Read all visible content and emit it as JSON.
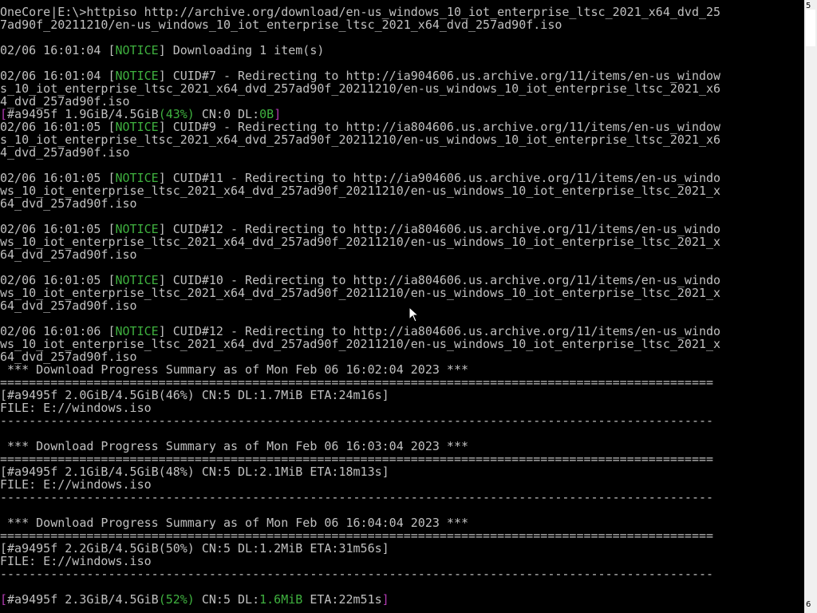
{
  "terminal": {
    "lines": [
      [
        {
          "t": "OneCore|E:\\>httpiso http://archive.org/download/en-us_windows_10_iot_enterprise_ltsc_2021_x64_dvd_25",
          "c": ""
        }
      ],
      [
        {
          "t": "7ad90f_20211210/en-us_windows_10_iot_enterprise_ltsc_2021_x64_dvd_257ad90f.iso",
          "c": ""
        }
      ],
      [],
      [
        {
          "t": "02/06 16:01:04 [",
          "c": ""
        },
        {
          "t": "NOTICE",
          "c": "notice"
        },
        {
          "t": "] Downloading 1 item(s)",
          "c": ""
        }
      ],
      [],
      [
        {
          "t": "02/06 16:01:04 [",
          "c": ""
        },
        {
          "t": "NOTICE",
          "c": "notice"
        },
        {
          "t": "] CUID#7 - Redirecting to http://ia904606.us.archive.org/11/items/en-us_window",
          "c": ""
        }
      ],
      [
        {
          "t": "s_10_iot_enterprise_ltsc_2021_x64_dvd_257ad90f_20211210/en-us_windows_10_iot_enterprise_ltsc_2021_x6",
          "c": ""
        }
      ],
      [
        {
          "t": "4_dvd_257ad90f.iso",
          "c": ""
        }
      ],
      [
        {
          "t": "[",
          "c": "magenta"
        },
        {
          "t": "#a9495f 1.9GiB/4.5GiB",
          "c": ""
        },
        {
          "t": "(43%)",
          "c": "green"
        },
        {
          "t": " CN:0 DL:",
          "c": ""
        },
        {
          "t": "0B",
          "c": "green"
        },
        {
          "t": "]",
          "c": "magenta"
        }
      ],
      [
        {
          "t": "02/06 16:01:05 [",
          "c": ""
        },
        {
          "t": "NOTICE",
          "c": "notice"
        },
        {
          "t": "] CUID#9 - Redirecting to http://ia804606.us.archive.org/11/items/en-us_window",
          "c": ""
        }
      ],
      [
        {
          "t": "s_10_iot_enterprise_ltsc_2021_x64_dvd_257ad90f_20211210/en-us_windows_10_iot_enterprise_ltsc_2021_x6",
          "c": ""
        }
      ],
      [
        {
          "t": "4_dvd_257ad90f.iso",
          "c": ""
        }
      ],
      [],
      [
        {
          "t": "02/06 16:01:05 [",
          "c": ""
        },
        {
          "t": "NOTICE",
          "c": "notice"
        },
        {
          "t": "] CUID#11 - Redirecting to http://ia904606.us.archive.org/11/items/en-us_windo",
          "c": ""
        }
      ],
      [
        {
          "t": "ws_10_iot_enterprise_ltsc_2021_x64_dvd_257ad90f_20211210/en-us_windows_10_iot_enterprise_ltsc_2021_x",
          "c": ""
        }
      ],
      [
        {
          "t": "64_dvd_257ad90f.iso",
          "c": ""
        }
      ],
      [],
      [
        {
          "t": "02/06 16:01:05 [",
          "c": ""
        },
        {
          "t": "NOTICE",
          "c": "notice"
        },
        {
          "t": "] CUID#12 - Redirecting to http://ia804606.us.archive.org/11/items/en-us_windo",
          "c": ""
        }
      ],
      [
        {
          "t": "ws_10_iot_enterprise_ltsc_2021_x64_dvd_257ad90f_20211210/en-us_windows_10_iot_enterprise_ltsc_2021_x",
          "c": ""
        }
      ],
      [
        {
          "t": "64_dvd_257ad90f.iso",
          "c": ""
        }
      ],
      [],
      [
        {
          "t": "02/06 16:01:05 [",
          "c": ""
        },
        {
          "t": "NOTICE",
          "c": "notice"
        },
        {
          "t": "] CUID#10 - Redirecting to http://ia804606.us.archive.org/11/items/en-us_windo",
          "c": ""
        }
      ],
      [
        {
          "t": "ws_10_iot_enterprise_ltsc_2021_x64_dvd_257ad90f_20211210/en-us_windows_10_iot_enterprise_ltsc_2021_x",
          "c": ""
        }
      ],
      [
        {
          "t": "64_dvd_257ad90f.iso",
          "c": ""
        }
      ],
      [],
      [
        {
          "t": "02/06 16:01:06 [",
          "c": ""
        },
        {
          "t": "NOTICE",
          "c": "notice"
        },
        {
          "t": "] CUID#12 - Redirecting to http://ia804606.us.archive.org/11/items/en-us_windo",
          "c": ""
        }
      ],
      [
        {
          "t": "ws_10_iot_enterprise_ltsc_2021_x64_dvd_257ad90f_20211210/en-us_windows_10_iot_enterprise_ltsc_2021_x",
          "c": ""
        }
      ],
      [
        {
          "t": "64_dvd_257ad90f.iso",
          "c": ""
        }
      ],
      [
        {
          "t": " *** Download Progress Summary as of Mon Feb 06 16:02:04 2023 ***",
          "c": ""
        }
      ],
      [
        {
          "t": "===================================================================================================",
          "c": ""
        }
      ],
      [
        {
          "t": "[#a9495f 2.0GiB/4.5GiB(46%) CN:5 DL:1.7MiB ETA:24m16s]",
          "c": ""
        }
      ],
      [
        {
          "t": "FILE: E://windows.iso",
          "c": ""
        }
      ],
      [
        {
          "t": "---------------------------------------------------------------------------------------------------",
          "c": ""
        }
      ],
      [],
      [
        {
          "t": " *** Download Progress Summary as of Mon Feb 06 16:03:04 2023 ***",
          "c": ""
        }
      ],
      [
        {
          "t": "===================================================================================================",
          "c": ""
        }
      ],
      [
        {
          "t": "[#a9495f 2.1GiB/4.5GiB(48%) CN:5 DL:2.1MiB ETA:18m13s]",
          "c": ""
        }
      ],
      [
        {
          "t": "FILE: E://windows.iso",
          "c": ""
        }
      ],
      [
        {
          "t": "---------------------------------------------------------------------------------------------------",
          "c": ""
        }
      ],
      [],
      [
        {
          "t": " *** Download Progress Summary as of Mon Feb 06 16:04:04 2023 ***",
          "c": ""
        }
      ],
      [
        {
          "t": "===================================================================================================",
          "c": ""
        }
      ],
      [
        {
          "t": "[#a9495f 2.2GiB/4.5GiB(50%) CN:5 DL:1.2MiB ETA:31m56s]",
          "c": ""
        }
      ],
      [
        {
          "t": "FILE: E://windows.iso",
          "c": ""
        }
      ],
      [
        {
          "t": "---------------------------------------------------------------------------------------------------",
          "c": ""
        }
      ],
      [],
      [
        {
          "t": "[",
          "c": "magenta"
        },
        {
          "t": "#a9495f 2.3GiB/4.5GiB",
          "c": ""
        },
        {
          "t": "(52%)",
          "c": "green"
        },
        {
          "t": " CN:5 DL:",
          "c": ""
        },
        {
          "t": "1.6MiB",
          "c": "green"
        },
        {
          "t": " ETA:22m51s",
          "c": ""
        },
        {
          "t": "]",
          "c": "magenta"
        }
      ]
    ]
  },
  "scrollbar": {
    "top_label": "5",
    "bottom_label": "6"
  },
  "colors": {
    "background": "#000000",
    "text": "#c0c0c0",
    "notice": "#3fb13f",
    "bracket": "#b33ab3"
  },
  "cursor": {
    "icon": "mouse-pointer-icon"
  }
}
